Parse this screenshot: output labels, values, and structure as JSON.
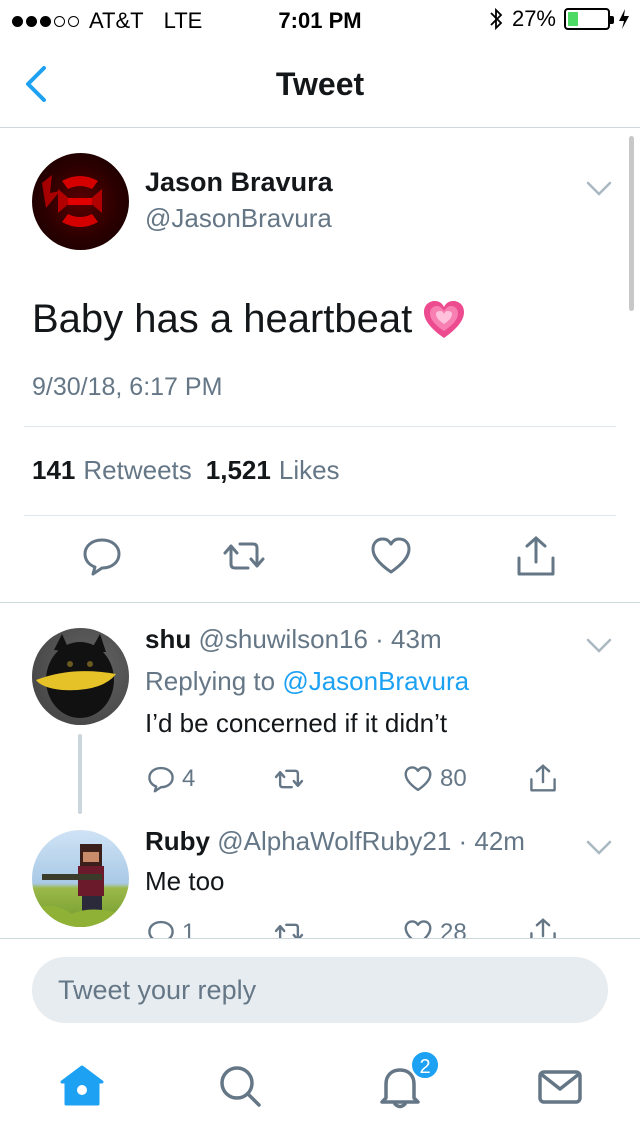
{
  "status_bar": {
    "carrier": "AT&T",
    "network": "LTE",
    "time": "7:01 PM",
    "battery_percent": "27%",
    "battery_level": 0.27,
    "battery_color": "#4cd964"
  },
  "nav": {
    "back_icon": "chevron-left-icon",
    "title": "Tweet"
  },
  "tweet": {
    "author_name": "Jason Bravura",
    "author_handle": "@JasonBravura",
    "text": "Baby has a heartbeat",
    "emoji": "sparkling-heart-emoji",
    "date": "9/30/18, 6:17 PM",
    "retweets_count": "141",
    "retweets_label": "Retweets",
    "likes_count": "1,521",
    "likes_label": "Likes",
    "actions": [
      "reply-icon",
      "retweet-icon",
      "like-icon",
      "share-icon"
    ]
  },
  "replies": [
    {
      "name": "shu",
      "handle": "@shuwilson16 · 43m",
      "replying_prefix": "Replying to",
      "replying_to": "@JasonBravura",
      "text": "I’d be concerned if it didn’t",
      "reply_count": "4",
      "retweet_count": "",
      "like_count": "80"
    },
    {
      "name": "Ruby",
      "handle": "@AlphaWolfRuby21 · 42m",
      "text": "Me too",
      "reply_count": "1",
      "retweet_count": "",
      "like_count": "28"
    }
  ],
  "composer": {
    "placeholder": "Tweet your reply"
  },
  "tabbar": {
    "tabs": [
      "home-icon",
      "search-icon",
      "notifications-icon",
      "messages-icon"
    ],
    "notification_badge": "2"
  },
  "colors": {
    "accent": "#1da1f2",
    "secondary_text": "#657786",
    "divider": "#ccd6dd"
  }
}
